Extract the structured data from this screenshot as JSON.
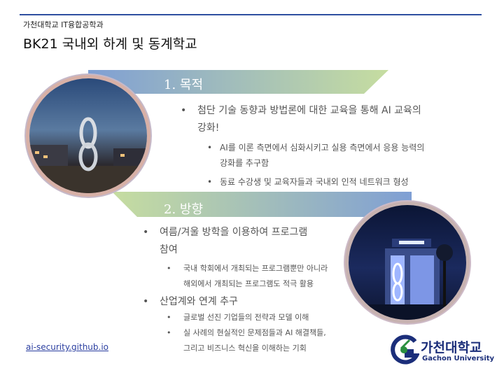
{
  "header": {
    "department": "가천대학교 IT융합공학과",
    "title": "BK21 국내외 하계 및 동계학교"
  },
  "sections": [
    {
      "label": "1. 목적",
      "bullets": [
        {
          "text_line1": "첨단 기술 동향과 방법론에 대한 교육을 통해 AI 교육의",
          "text_line2": "강화!",
          "sub": [
            {
              "line1": "AI를 이론 측면에서 심화시키고 실용 측면에서 응용 능력의",
              "line2": "강화를 추구함"
            },
            {
              "line1": "동료 수강생 및 교육자들과 국내외 인적 네트워크 형성",
              "line2": ""
            }
          ]
        }
      ]
    },
    {
      "label": "2. 방향",
      "bullets": [
        {
          "text_line1": "여름/겨울 방학을 이용하여 프로그램",
          "text_line2": "참여",
          "sub": [
            {
              "line1": "국내 학회에서 개최되는 프로그램뿐만 아니라",
              "line2": "해외에서 개최되는 프로그램도 적극 활용"
            }
          ]
        },
        {
          "text_line1": "산업계와 연계 추구",
          "text_line2": "",
          "sub": [
            {
              "line1": "글로벌 선진 기업들의 전략과 모델 이해",
              "line2": ""
            },
            {
              "line1": "실 사례의 현실적인 문제점들과 AI 해결책들,",
              "line2": "그리고 비즈니스 혁신을 이해하는 기회"
            }
          ]
        }
      ]
    }
  ],
  "footer": {
    "url": "ai-security.github.io"
  },
  "logo": {
    "korean": "가천대학교",
    "english": "Gachon University"
  },
  "colors": {
    "band_start": "#7f9fd4",
    "band_end": "#c6dda0",
    "rule": "#2f4fa0",
    "logo": "#1b2e7a"
  },
  "images": {
    "photo1": "infinity sculpture at dusk",
    "photo2": "lit university building at night"
  }
}
